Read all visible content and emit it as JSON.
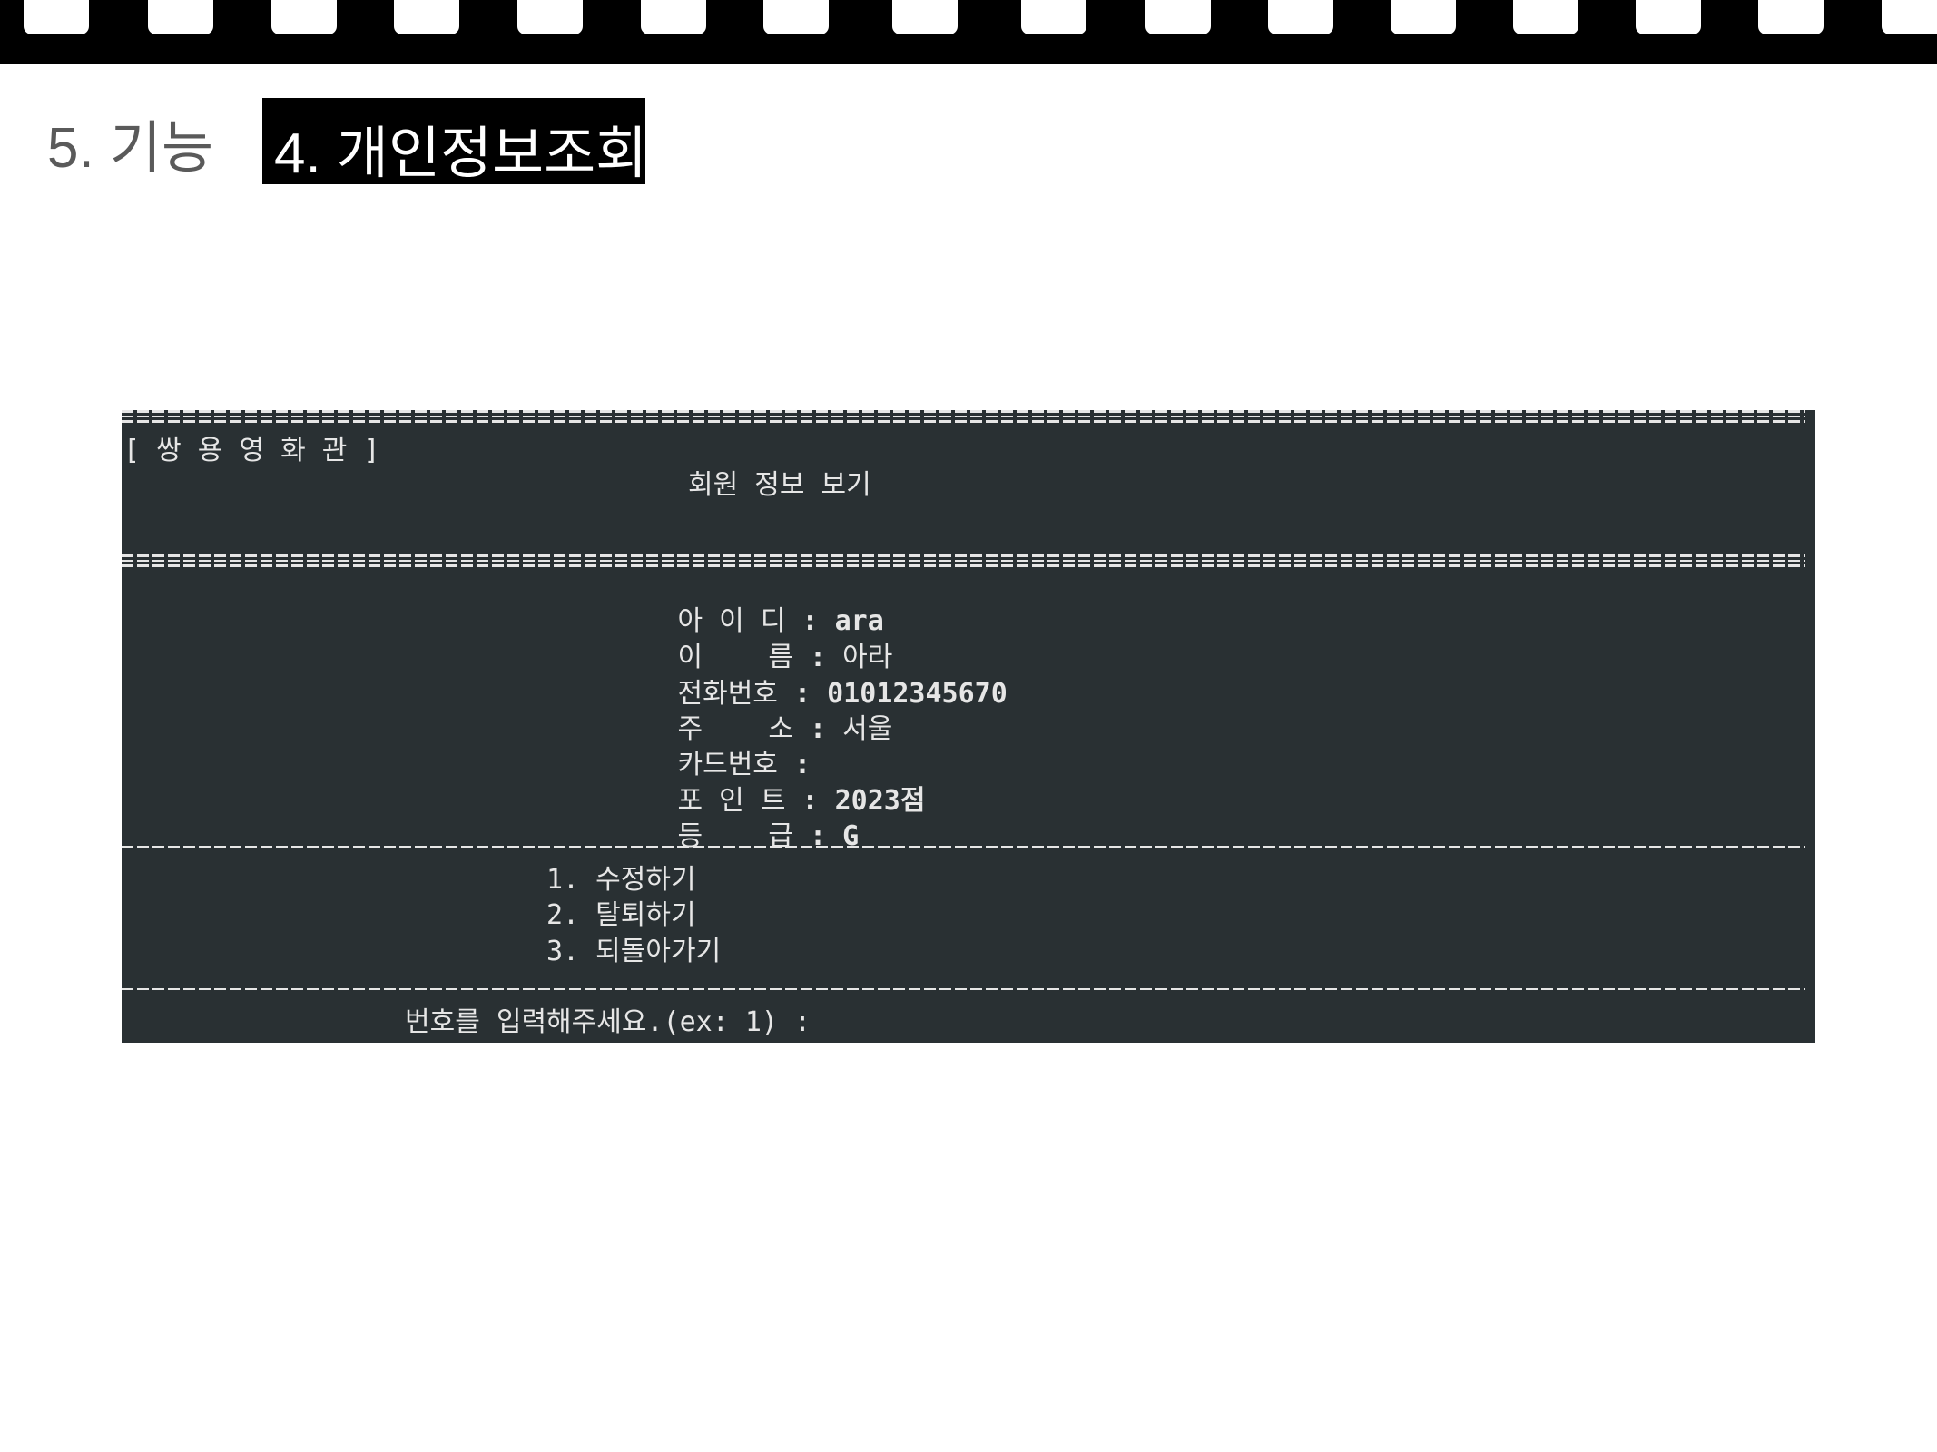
{
  "header": {
    "section": "5. 기능",
    "title": "4. 개인정보조회"
  },
  "terminal": {
    "brand": "[ 쌍 용 영 화 관 ]",
    "screen_title": "회원 정보 보기",
    "fields": [
      {
        "label": "아 이 디",
        "value": "ara"
      },
      {
        "label": "이    름",
        "value": "아라"
      },
      {
        "label": "전화번호",
        "value": "01012345670"
      },
      {
        "label": "주    소",
        "value": "서울"
      },
      {
        "label": "카드번호",
        "value": ""
      },
      {
        "label": "포 인 트",
        "value": "2023점"
      },
      {
        "label": "등    급",
        "value": "G"
      }
    ],
    "menu": [
      "1. 수정하기",
      "2. 탈퇴하기",
      "3. 되돌아가기"
    ],
    "prompt": "번호를 입력해주세요.(ex: 1) :"
  },
  "colors": {
    "terminal_bg": "#293033",
    "terminal_fg": "#e6e6e6",
    "section_text": "#5a5a5a",
    "title_box": "#000000"
  }
}
